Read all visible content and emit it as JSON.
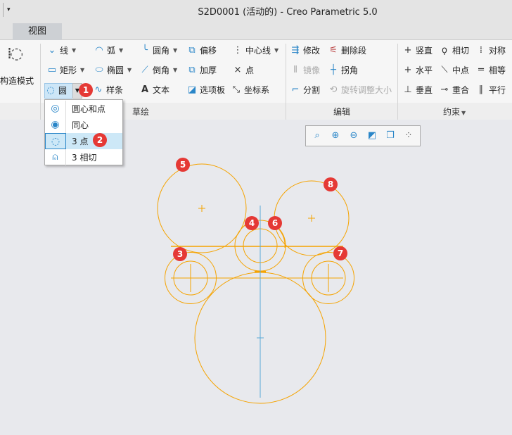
{
  "window": {
    "title": "S2D0001 (活动的) - Creo Parametric 5.0",
    "quick_access": "▾"
  },
  "tabs": [
    {
      "label": "视图"
    }
  ],
  "ribbon": {
    "construction_mode": "构造模式",
    "sketch": {
      "group_label": "草绘",
      "items": {
        "line": "线",
        "arc": "弧",
        "fillet": "圆角",
        "offset": "偏移",
        "centerline": "中心线",
        "rectangle": "矩形",
        "ellipse": "椭圆",
        "chamfer": "倒角",
        "thicken": "加厚",
        "point": "点",
        "circle": "圆",
        "spline": "样条",
        "text": "文本",
        "palette": "选项板",
        "coord_sys": "坐标系"
      }
    },
    "edit": {
      "group_label": "编辑",
      "items": {
        "modify": "修改",
        "delete_segment": "删除段",
        "mirror": "镜像",
        "corner": "拐角",
        "divide": "分割",
        "rotate_resize": "旋转调整大小"
      }
    },
    "constrain": {
      "group_label": "约束",
      "items": {
        "vertical": "竖直",
        "tangent": "相切",
        "symmetric": "对称",
        "horizontal": "水平",
        "midpoint": "中点",
        "equal": "相等",
        "perpendicular": "垂直",
        "coincident": "重合",
        "parallel": "平行"
      }
    }
  },
  "circle_menu": {
    "items": [
      {
        "label": "圆心和点",
        "icon": "center-point-circle-icon"
      },
      {
        "label": "同心",
        "icon": "concentric-icon"
      },
      {
        "label": "3 点",
        "icon": "three-point-circle-icon",
        "selected": true
      },
      {
        "label": "3 相切",
        "icon": "three-tangent-icon"
      }
    ]
  },
  "badges": [
    "1",
    "2",
    "3",
    "4",
    "5",
    "6",
    "7",
    "8"
  ],
  "colors": {
    "sketch": "#f5a300",
    "centerline": "#5aa9d6",
    "badge": "#e53935"
  }
}
